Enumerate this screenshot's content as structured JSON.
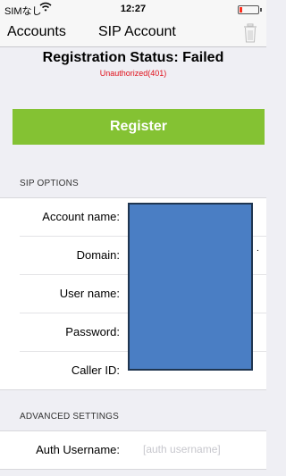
{
  "status_bar": {
    "carrier": "SIMなし",
    "time": "12:27",
    "battery_level": 0.15,
    "battery_color": "#ff2d1c"
  },
  "nav": {
    "back_label": "Accounts",
    "title": "SIP Account",
    "trash_icon": "trash-icon"
  },
  "registration": {
    "status": "Registration Status: Failed",
    "reason": "Unauthorized(401)",
    "register_label": "Register",
    "register_color": "#84c233"
  },
  "sip_options": {
    "header": "SIP OPTIONS",
    "rows": [
      {
        "label": "Account name:"
      },
      {
        "label": "Domain:"
      },
      {
        "label": "User name:"
      },
      {
        "label": "Password:"
      },
      {
        "label": "Caller ID:"
      }
    ]
  },
  "advanced": {
    "header": "ADVANCED SETTINGS",
    "rows": [
      {
        "label": "Auth Username:",
        "placeholder": "[auth username]"
      }
    ]
  }
}
